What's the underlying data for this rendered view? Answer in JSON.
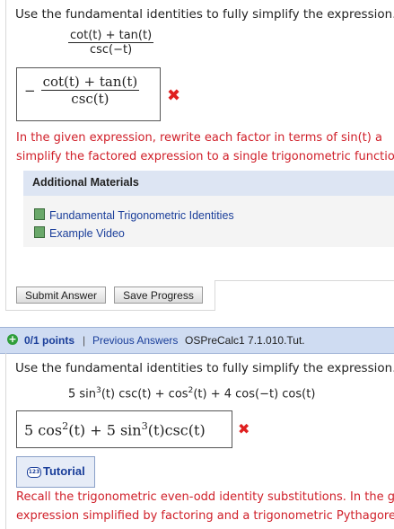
{
  "q1": {
    "prompt": "Use the fundamental identities to fully simplify the expression.",
    "expr_num": "cot(t) + tan(t)",
    "expr_den": "csc(−t)",
    "answer_sign": "−",
    "answer_num": "cot(t) + tan(t)",
    "answer_den": "csc(t)",
    "feedback_line1": "In the given expression, rewrite each factor in terms of  sin(t)  a",
    "feedback_line2": "simplify the factored expression to a single trigonometric functio",
    "materials": {
      "heading": "Additional Materials",
      "links": [
        "Fundamental Trigonometric Identities",
        "Example Video"
      ]
    },
    "submit_label": "Submit Answer",
    "save_label": "Save Progress"
  },
  "info_bar": {
    "points": "0/1 points",
    "separator": "|",
    "prev_answers": "Previous Answers",
    "problem_id": "OSPreCalc1 7.1.010.Tut."
  },
  "q2": {
    "prompt": "Use the fundamental identities to fully simplify the expression.",
    "expr_a": "5 sin",
    "expr_a_exp": "3",
    "expr_b": "(t) csc(t) + cos",
    "expr_b_exp": "2",
    "expr_c": "(t) + 4 cos(−t) cos(t)",
    "answer_a": "5 cos",
    "answer_a_exp": "2",
    "answer_b": "(t) + 5 sin",
    "answer_b_exp": "3",
    "answer_c": "(t)csc(t)",
    "tutorial_label": "Tutorial",
    "tutorial_icon_text": "123",
    "feedback_line1": "Recall the trigonometric even-odd identity substitutions. In the g",
    "feedback_line2": "expression simplified by factoring and a trigonometric Pythagore"
  },
  "colors": {
    "error_red": "#d0202a",
    "link_blue": "#1a3e9a",
    "info_bar_bg": "#cfdcf2"
  }
}
